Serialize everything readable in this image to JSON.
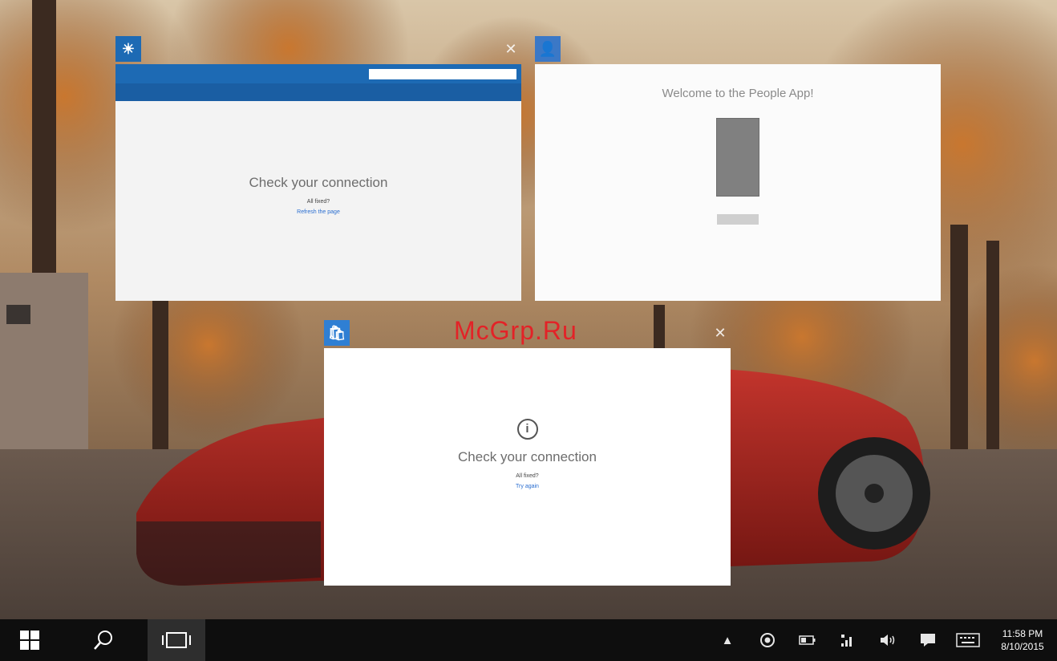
{
  "watermark": "McGrp.Ru",
  "windows": {
    "msn": {
      "icon": "sun-icon",
      "accent": "#1d6ab4",
      "message": "Check your connection",
      "submessage": "All fixed?",
      "link": "Refresh the page"
    },
    "people": {
      "icon": "people-icon",
      "accent": "#3b78c6",
      "title": "Welcome to the People App!"
    },
    "store": {
      "icon": "store-icon",
      "accent": "#2f7fd3",
      "message": "Check your connection",
      "submessage": "All fixed?",
      "link": "Try again"
    }
  },
  "taskbar": {
    "start_icon": "windows-logo-icon",
    "search_icon": "search-icon",
    "taskview_icon": "task-view-icon",
    "tray": [
      "show-hidden-icons-icon",
      "location-icon",
      "battery-icon",
      "network-icon",
      "volume-icon",
      "notifications-icon",
      "keyboard-icon"
    ],
    "time": "11:58 PM",
    "date": "8/10/2015"
  }
}
